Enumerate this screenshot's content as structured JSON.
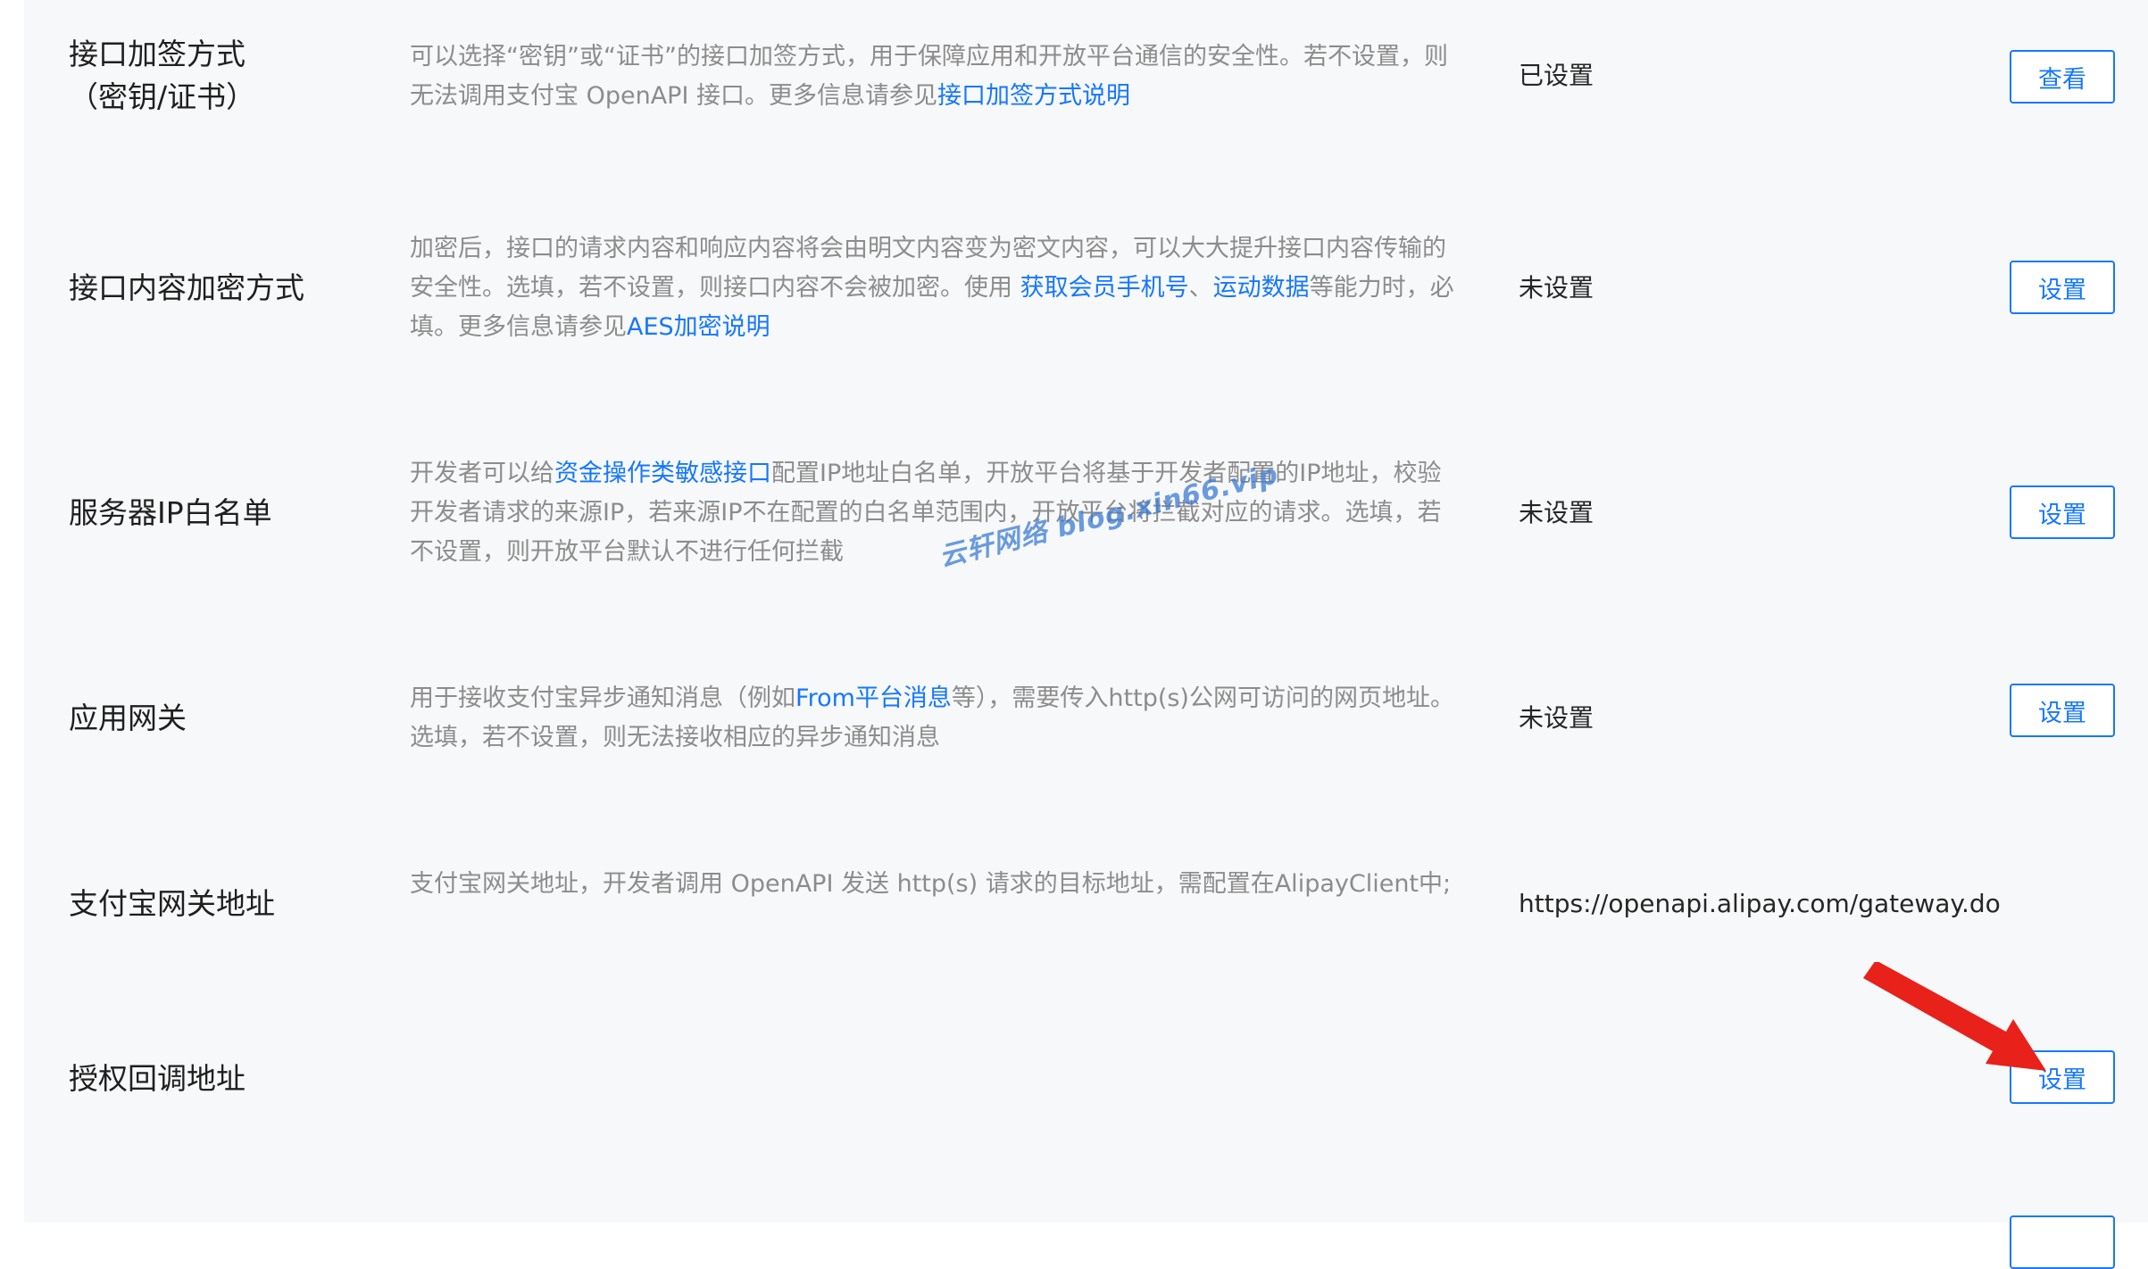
{
  "rows": [
    {
      "label_lines": [
        "接口加签方式",
        "（密钥/证书）"
      ],
      "desc_parts": [
        {
          "text": "可以选择“密钥”或“证书”的接口加签方式，用于保障应用和开放平台通信的安全性。若不设置，则无法调用支付宝 OpenAPI 接口。更多信息请参见"
        },
        {
          "link": "接口加签方式说明"
        }
      ],
      "status": "已设置",
      "button": "查看"
    },
    {
      "label": "接口内容加密方式",
      "desc_parts": [
        {
          "text": "加密后，接口的请求内容和响应内容将会由明文内容变为密文内容，可以大大提升接口内容传输的安全性。选填，若不设置，则接口内容不会被加密。使用 "
        },
        {
          "link": "获取会员手机号"
        },
        {
          "text": "、"
        },
        {
          "link": "运动数据"
        },
        {
          "text": "等能力时，必填。更多信息请参见"
        },
        {
          "link": "AES加密说明"
        }
      ],
      "status": "未设置",
      "button": "设置"
    },
    {
      "label": "服务器IP白名单",
      "desc_parts": [
        {
          "text": "开发者可以给"
        },
        {
          "link": "资金操作类敏感接口"
        },
        {
          "text": "配置IP地址白名单，开放平台将基于开发者配置的IP地址，校验开发者请求的来源IP，若来源IP不在配置的白名单范围内，开放平台将拦截对应的请求。选填，若不设置，则开放平台默认不进行任何拦截"
        }
      ],
      "status": "未设置",
      "button": "设置"
    },
    {
      "label": "应用网关",
      "desc_parts": [
        {
          "text": "用于接收支付宝异步通知消息（例如"
        },
        {
          "link": "From平台消息"
        },
        {
          "text": "等），需要传入http(s)公网可访问的网页地址。选填，若不设置，则无法接收相应的异步通知消息"
        }
      ],
      "status": "未设置",
      "button": "设置"
    },
    {
      "label": "支付宝网关地址",
      "desc_parts": [
        {
          "text": "支付宝网关地址，开发者调用 OpenAPI 发送 http(s) 请求的目标地址，需配置在AlipayClient中;"
        }
      ],
      "status": "https://openapi.alipay.com/gateway.do"
    },
    {
      "label": "授权回调地址",
      "button": "设置"
    }
  ],
  "watermark": "云轩网络  blog.xin66.vip",
  "colors": {
    "accent": "#1677ff",
    "panel_bg": "#f7f8fa",
    "arrow": "#e8211b",
    "watermark": "#3a7bd5"
  }
}
